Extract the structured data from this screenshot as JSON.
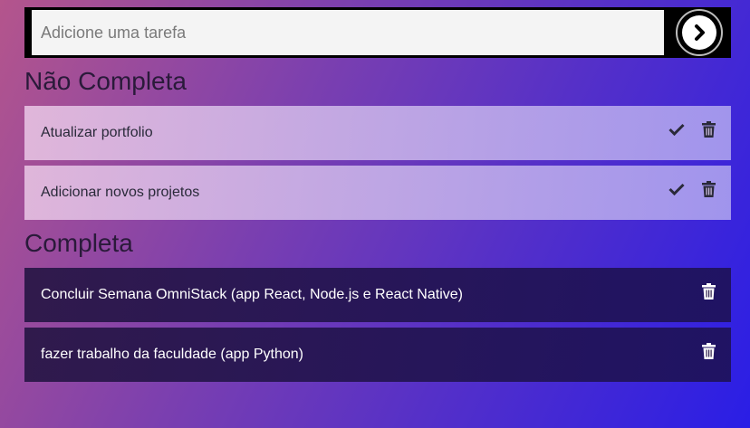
{
  "new_task": {
    "placeholder": "Adicione uma tarefa",
    "value": "",
    "submit_icon": "chevron-right-icon"
  },
  "sections": {
    "pending_title": "Não Completa",
    "done_title": "Completa"
  },
  "pending_tasks": [
    {
      "text": "Atualizar portfolio",
      "actions": [
        "check-icon",
        "trash-icon"
      ]
    },
    {
      "text": "Adicionar novos projetos",
      "actions": [
        "check-icon",
        "trash-icon"
      ]
    }
  ],
  "completed_tasks": [
    {
      "text": "Concluir Semana OmniStack (app React, Node.js e React Native)",
      "actions": [
        "trash-icon"
      ]
    },
    {
      "text": "fazer trabalho da faculdade (app Python)",
      "actions": [
        "trash-icon"
      ]
    }
  ],
  "colors": {
    "pending_icon": "#2a2a3a",
    "done_icon": "#ffffff"
  }
}
